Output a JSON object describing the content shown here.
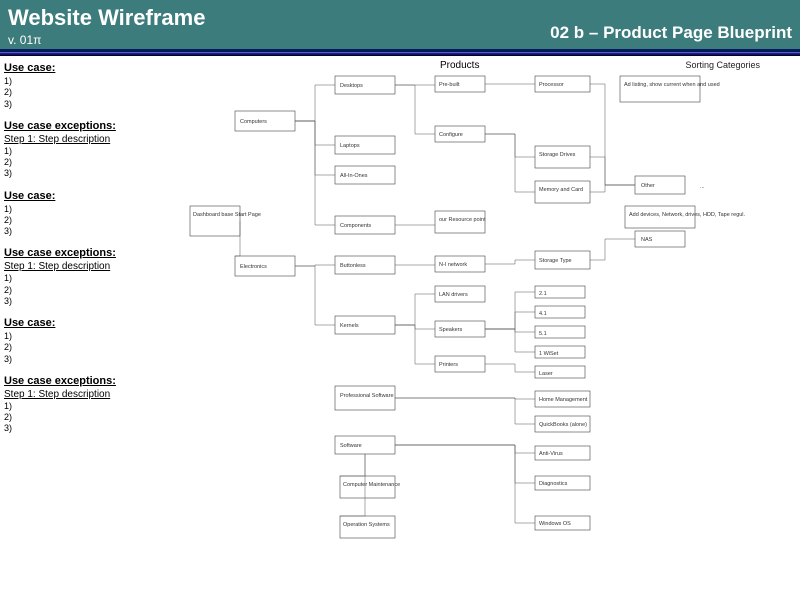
{
  "header": {
    "title": "Website Wireframe",
    "version": "v. 01π",
    "subtitle": "02 b – Product Page Blueprint"
  },
  "sidebar": {
    "blocks": [
      {
        "head": "Use case:",
        "step": "",
        "items": [
          "1)",
          "2)",
          "3)"
        ]
      },
      {
        "head": "Use case exceptions:",
        "step": "Step 1: Step description",
        "items": [
          "1)",
          "2)",
          "3)"
        ]
      },
      {
        "head": "Use case:",
        "step": "",
        "items": [
          "1)",
          "2)",
          "3)"
        ]
      },
      {
        "head": "Use case exceptions:",
        "step": "Step 1: Step description",
        "items": [
          "1)",
          "2)",
          "3)"
        ]
      },
      {
        "head": "Use case:",
        "step": "",
        "items": [
          "1)",
          "2)",
          "3)"
        ]
      },
      {
        "head": "Use case exceptions:",
        "step": "Step 1: Step description",
        "items": [
          "1)",
          "2)",
          "3)"
        ]
      }
    ]
  },
  "diagram": {
    "top_label_left": "Products",
    "top_label_right": "Sorting Categories",
    "sort_note": "Ad listing, show current when and used",
    "nodes": {
      "col1": [
        "Computers",
        "Electronics"
      ],
      "col1_sub": "Dashboard base Start Page",
      "col2": [
        "Desktops",
        "Laptops",
        "All-In-Ones",
        "Components",
        "Buttonless",
        "Kernels",
        "Professional Software",
        "Software"
      ],
      "col2_sub": [
        "Computer Maintenance",
        "Operation Systems"
      ],
      "col3_top": [
        "Pre-built",
        "Configure",
        "our Resource point"
      ],
      "col3_mid": [
        "N-I network",
        "LAN drivers",
        "Speakers",
        "Printers"
      ],
      "col4_top": [
        "Processor",
        "Storage Drives",
        "Memory and Card",
        "Storage Type"
      ],
      "col4_tiny": [
        "2.1",
        "4.1",
        "5.1",
        "1 WiSet",
        "Laser",
        "Home Management",
        "QuickBooks (alone)",
        "Anti-Virus",
        "Diagnostics",
        "Windows OS"
      ],
      "col5_top": "Other",
      "col5_mid": "NAS",
      "col5_note": "Add devices, Network, drives, HDD, Tape regul."
    }
  }
}
